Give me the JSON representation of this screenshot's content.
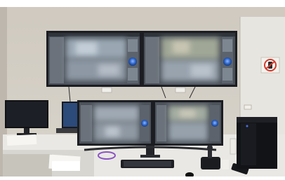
{
  "scene": {
    "colors": {
      "wall": "#d9d6cf",
      "wall_right": "#e6e4df",
      "floor": "#c9c6bf",
      "monitor_frame": "#1b1d22",
      "screen_ui": "#4a5058",
      "screen_blur": "#8e9aa6",
      "desk": "#e9e8e4",
      "tower": "#121317",
      "sign_red": "#d33a2c"
    },
    "icons": {
      "no_phone_sign": "no-mobile-phone-sign",
      "radial_widget": "blue-circular-control"
    }
  }
}
